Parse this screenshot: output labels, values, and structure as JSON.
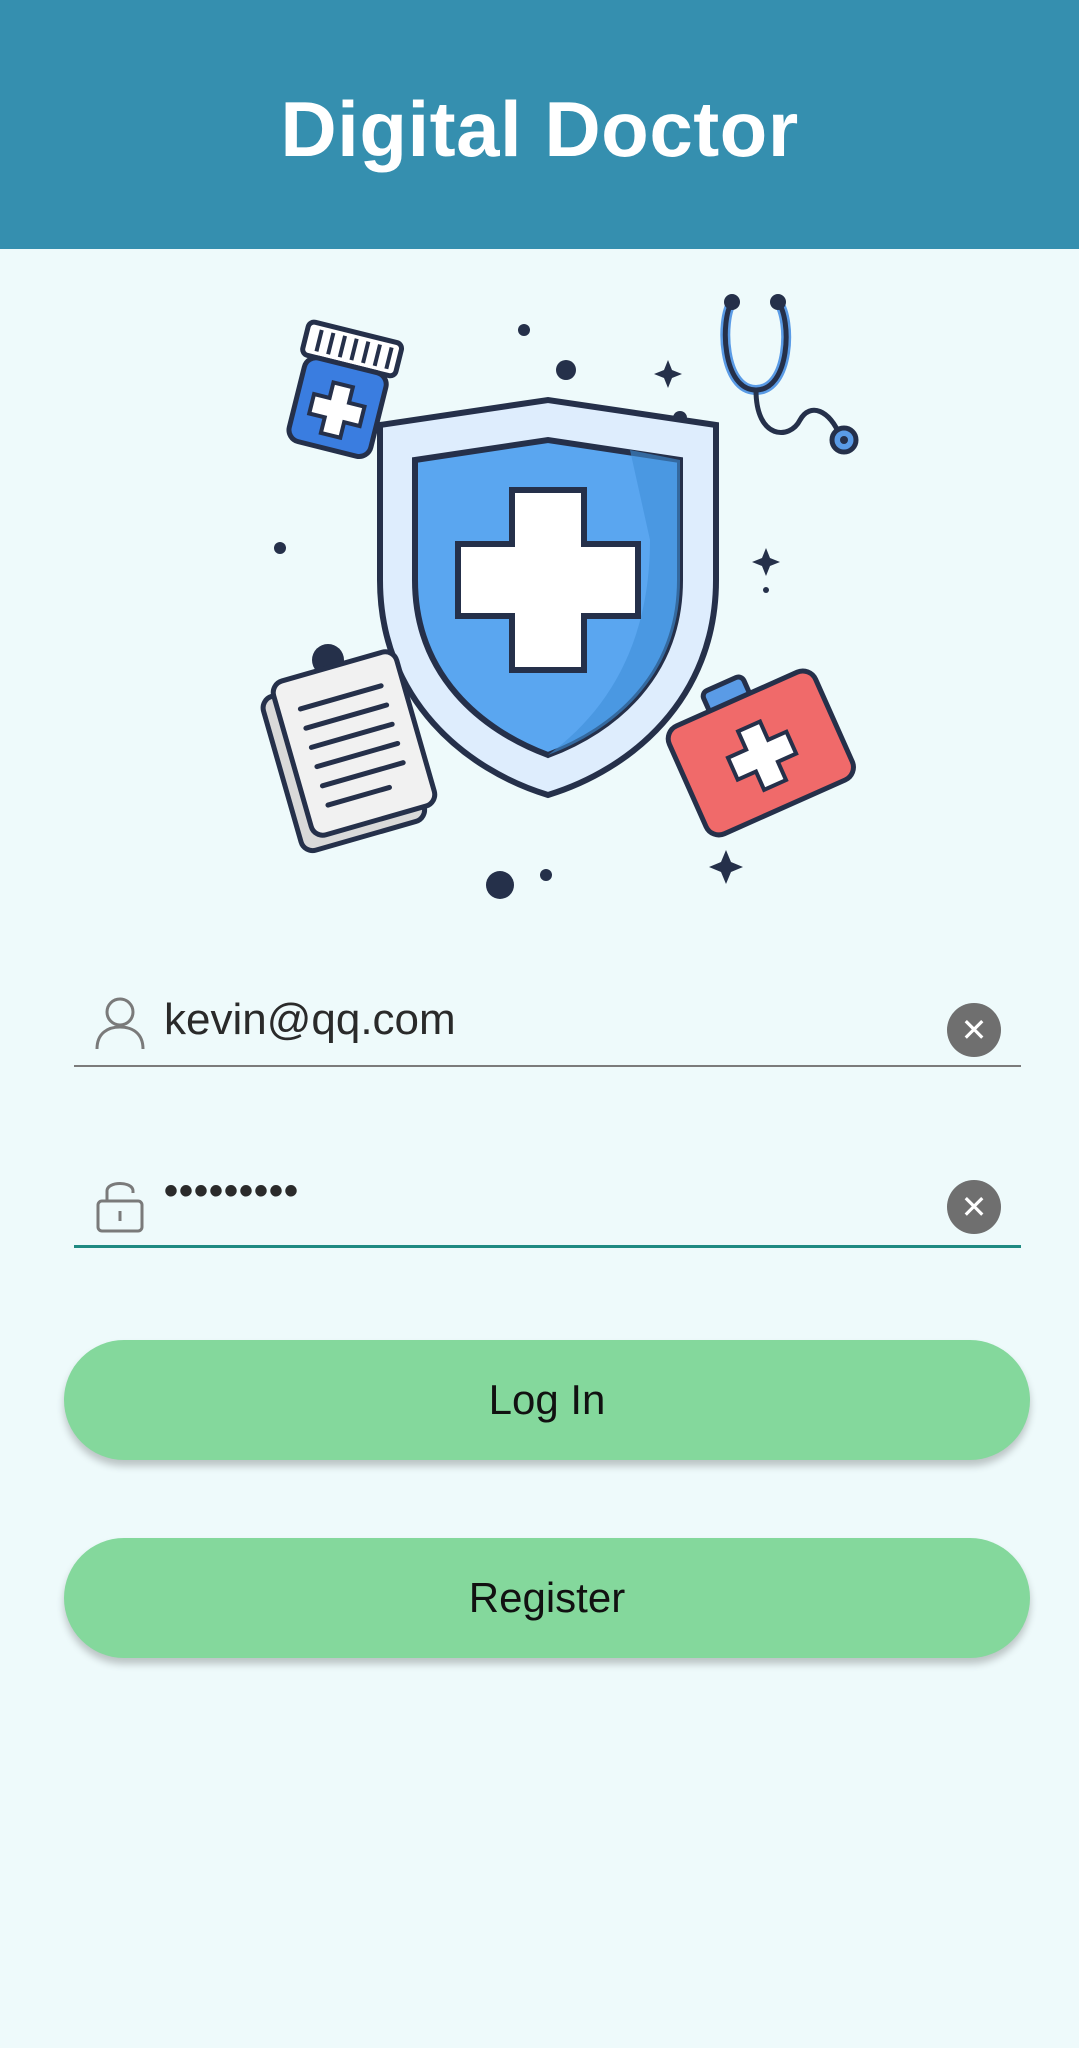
{
  "header": {
    "title": "Digital Doctor"
  },
  "illustration": {
    "icon": "medical-shield-illustration"
  },
  "login_form": {
    "email": {
      "value": "kevin@qq.com",
      "icon": "user-icon"
    },
    "password": {
      "value": "•••••••••",
      "icon": "unlock-icon"
    },
    "clear_icon_glyph": "✕"
  },
  "buttons": {
    "login_label": "Log In",
    "register_label": "Register"
  },
  "colors": {
    "header": "#358faf",
    "background": "#eefafb",
    "button": "#84d89c",
    "active_underline": "#1f8a82"
  }
}
